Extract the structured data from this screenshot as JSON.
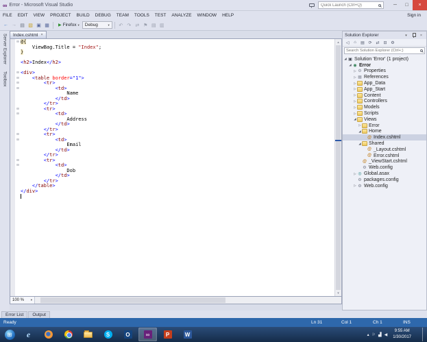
{
  "colors": {
    "statusbar": "#2e68ac",
    "taskbar_top": "#2b4c78",
    "taskbar_bottom": "#152c49",
    "close_button": "#d6493f",
    "selection": "#ccd2e2"
  },
  "glyphs": {
    "chevron_down": "▾",
    "scroll_up": "▴",
    "scroll_down": "▾",
    "fold_box": "⊟",
    "expander_expanded": "◢",
    "expander_collapsed": "▷"
  },
  "titlebar": {
    "logo_glyph": "∞",
    "title": "Error - Microsoft Visual Studio",
    "quick_launch_placeholder": "Quick Launch (Ctrl+Q)",
    "minimize_glyph": "─",
    "maximize_glyph": "□",
    "close_glyph": "×"
  },
  "menubar": {
    "items": [
      "FILE",
      "EDIT",
      "VIEW",
      "PROJECT",
      "BUILD",
      "DEBUG",
      "TEAM",
      "TOOLS",
      "TEST",
      "ANALYZE",
      "WINDOW",
      "HELP"
    ],
    "sign_in": "Sign in"
  },
  "toolbar": {
    "icons_left": [
      {
        "name": "navigate-back-icon",
        "glyph": "←",
        "color": "#3a76c4"
      },
      {
        "name": "navigate-forward-icon",
        "glyph": "→",
        "color": "#9aa0ae"
      },
      {
        "name": "new-file-icon",
        "glyph": "▤",
        "color": "#6b7380"
      },
      {
        "name": "open-file-icon",
        "glyph": "▧",
        "color": "#c9a227"
      },
      {
        "name": "save-icon",
        "glyph": "▣",
        "color": "#5b6b9e"
      },
      {
        "name": "save-all-icon",
        "glyph": "▦",
        "color": "#5b6b9e"
      }
    ],
    "run_play_glyph": "▶",
    "run_label": "Firefox",
    "config_label": "Debug",
    "icons_right": [
      {
        "name": "undo-icon",
        "glyph": "↶",
        "color": "#9aa0ae"
      },
      {
        "name": "redo-icon",
        "glyph": "↷",
        "color": "#9aa0ae"
      },
      {
        "name": "sync-icon",
        "glyph": "⇄",
        "color": "#9aa0ae"
      },
      {
        "name": "bookmark-icon",
        "glyph": "⚑",
        "color": "#9aa0ae"
      },
      {
        "name": "comment-icon",
        "glyph": "▤",
        "color": "#9aa0ae"
      },
      {
        "name": "outline-icon",
        "glyph": "▥",
        "color": "#9aa0ae"
      }
    ]
  },
  "side_tabs": {
    "items": [
      "Server Explorer",
      "Toolbox"
    ]
  },
  "editor": {
    "tab_label": "Index.cshtml",
    "tab_close_glyph": "×",
    "zoom_level": "100 %",
    "lines": [
      {
        "f": 1,
        "s": [
          [
            "rz",
            "@{"
          ]
        ]
      },
      {
        "s": [
          [
            "pl",
            "    ViewBag.Title = "
          ],
          [
            "st",
            "\"Index\""
          ],
          [
            "pl",
            ";"
          ]
        ]
      },
      {
        "s": [
          [
            "rz",
            "}"
          ]
        ]
      },
      {
        "s": []
      },
      {
        "s": [
          [
            "dl",
            "<"
          ],
          [
            "tg",
            "h2"
          ],
          [
            "dl",
            ">"
          ],
          [
            "pl",
            "Index"
          ],
          [
            "dl",
            "</"
          ],
          [
            "tg",
            "h2"
          ],
          [
            "dl",
            ">"
          ]
        ]
      },
      {
        "s": []
      },
      {
        "f": 1,
        "s": [
          [
            "dl",
            "<"
          ],
          [
            "tg",
            "div"
          ],
          [
            "dl",
            ">"
          ]
        ]
      },
      {
        "f": 1,
        "s": [
          [
            "pl",
            "    "
          ],
          [
            "dl",
            "<"
          ],
          [
            "tg",
            "table"
          ],
          [
            "pl",
            " "
          ],
          [
            "at",
            "border"
          ],
          [
            "dl",
            "=\"1\""
          ],
          [
            "dl",
            ">"
          ]
        ]
      },
      {
        "f": 1,
        "s": [
          [
            "pl",
            "        "
          ],
          [
            "dl",
            "<"
          ],
          [
            "tg",
            "tr"
          ],
          [
            "dl",
            ">"
          ]
        ]
      },
      {
        "f": 1,
        "s": [
          [
            "pl",
            "            "
          ],
          [
            "dl",
            "<"
          ],
          [
            "tg",
            "td"
          ],
          [
            "dl",
            ">"
          ]
        ]
      },
      {
        "s": [
          [
            "pl",
            "                Name"
          ]
        ]
      },
      {
        "s": [
          [
            "pl",
            "            "
          ],
          [
            "dl",
            "</"
          ],
          [
            "tg",
            "td"
          ],
          [
            "dl",
            ">"
          ]
        ]
      },
      {
        "s": [
          [
            "pl",
            "        "
          ],
          [
            "dl",
            "</"
          ],
          [
            "tg",
            "tr"
          ],
          [
            "dl",
            ">"
          ]
        ]
      },
      {
        "f": 1,
        "s": [
          [
            "pl",
            "        "
          ],
          [
            "dl",
            "<"
          ],
          [
            "tg",
            "tr"
          ],
          [
            "dl",
            ">"
          ]
        ]
      },
      {
        "f": 1,
        "s": [
          [
            "pl",
            "            "
          ],
          [
            "dl",
            "<"
          ],
          [
            "tg",
            "td"
          ],
          [
            "dl",
            ">"
          ]
        ]
      },
      {
        "s": [
          [
            "pl",
            "                Address"
          ]
        ]
      },
      {
        "s": [
          [
            "pl",
            "            "
          ],
          [
            "dl",
            "</"
          ],
          [
            "tg",
            "td"
          ],
          [
            "dl",
            ">"
          ]
        ]
      },
      {
        "s": [
          [
            "pl",
            "        "
          ],
          [
            "dl",
            "</"
          ],
          [
            "tg",
            "tr"
          ],
          [
            "dl",
            ">"
          ]
        ]
      },
      {
        "f": 1,
        "s": [
          [
            "pl",
            "        "
          ],
          [
            "dl",
            "<"
          ],
          [
            "tg",
            "tr"
          ],
          [
            "dl",
            ">"
          ]
        ]
      },
      {
        "f": 1,
        "s": [
          [
            "pl",
            "            "
          ],
          [
            "dl",
            "<"
          ],
          [
            "tg",
            "td"
          ],
          [
            "dl",
            ">"
          ]
        ]
      },
      {
        "s": [
          [
            "pl",
            "                Email"
          ]
        ]
      },
      {
        "s": [
          [
            "pl",
            "            "
          ],
          [
            "dl",
            "</"
          ],
          [
            "tg",
            "td"
          ],
          [
            "dl",
            ">"
          ]
        ]
      },
      {
        "s": [
          [
            "pl",
            "        "
          ],
          [
            "dl",
            "</"
          ],
          [
            "tg",
            "tr"
          ],
          [
            "dl",
            ">"
          ]
        ]
      },
      {
        "f": 1,
        "s": [
          [
            "pl",
            "        "
          ],
          [
            "dl",
            "<"
          ],
          [
            "tg",
            "tr"
          ],
          [
            "dl",
            ">"
          ]
        ]
      },
      {
        "f": 1,
        "s": [
          [
            "pl",
            "            "
          ],
          [
            "dl",
            "<"
          ],
          [
            "tg",
            "td"
          ],
          [
            "dl",
            ">"
          ]
        ]
      },
      {
        "s": [
          [
            "pl",
            "                Dob"
          ]
        ]
      },
      {
        "s": [
          [
            "pl",
            "            "
          ],
          [
            "dl",
            "</"
          ],
          [
            "tg",
            "td"
          ],
          [
            "dl",
            ">"
          ]
        ]
      },
      {
        "s": [
          [
            "pl",
            "        "
          ],
          [
            "dl",
            "</"
          ],
          [
            "tg",
            "tr"
          ],
          [
            "dl",
            ">"
          ]
        ]
      },
      {
        "s": [
          [
            "pl",
            "    "
          ],
          [
            "dl",
            "</"
          ],
          [
            "tg",
            "table"
          ],
          [
            "dl",
            ">"
          ]
        ]
      },
      {
        "s": [
          [
            "dl",
            "</"
          ],
          [
            "tg",
            "div"
          ],
          [
            "dl",
            ">"
          ]
        ]
      },
      {
        "caret": 1,
        "s": []
      }
    ]
  },
  "solution_explorer": {
    "title": "Solution Explorer",
    "header_icons": [
      {
        "name": "chevron-down-icon",
        "glyph": "▾"
      },
      {
        "name": "pin-icon",
        "glyph": ""
      },
      {
        "name": "close-icon",
        "glyph": "×"
      }
    ],
    "toolbar_icons": [
      {
        "name": "back-icon",
        "glyph": "◁"
      },
      {
        "name": "home-icon",
        "glyph": "⌂"
      },
      {
        "name": "show-all-files-icon",
        "glyph": "▤"
      },
      {
        "name": "refresh-icon",
        "glyph": "⟳"
      },
      {
        "name": "sync-with-active-document-icon",
        "glyph": "⇄"
      },
      {
        "name": "collapse-all-icon",
        "glyph": "⊟"
      },
      {
        "name": "properties-icon",
        "glyph": "⚙"
      }
    ],
    "search_placeholder": "Search Solution Explorer (Ctrl+;)",
    "icon_glyphs": {
      "folder": "",
      "cshtml": "@",
      "config": "⚙",
      "solution": "▣",
      "project": "◉",
      "references": "▦",
      "properties": "⚙",
      "asax": "◎"
    },
    "tree": [
      {
        "label": "Solution 'Error' (1 project)",
        "indent": 0,
        "icon": "solution",
        "expander": "expanded"
      },
      {
        "label": "Error",
        "indent": 1,
        "icon": "project",
        "expander": "expanded",
        "bold": true
      },
      {
        "label": "Properties",
        "indent": 2,
        "icon": "properties",
        "expander": "collapsed"
      },
      {
        "label": "References",
        "indent": 2,
        "icon": "references",
        "expander": "collapsed"
      },
      {
        "label": "App_Data",
        "indent": 2,
        "icon": "folder",
        "expander": "collapsed"
      },
      {
        "label": "App_Start",
        "indent": 2,
        "icon": "folder",
        "expander": "collapsed"
      },
      {
        "label": "Content",
        "indent": 2,
        "icon": "folder",
        "expander": "collapsed"
      },
      {
        "label": "Controllers",
        "indent": 2,
        "icon": "folder",
        "expander": "collapsed"
      },
      {
        "label": "Models",
        "indent": 2,
        "icon": "folder",
        "expander": "collapsed"
      },
      {
        "label": "Scripts",
        "indent": 2,
        "icon": "folder",
        "expander": "collapsed"
      },
      {
        "label": "Views",
        "indent": 2,
        "icon": "folder",
        "expander": "expanded"
      },
      {
        "label": "Error",
        "indent": 3,
        "icon": "folder",
        "expander": "collapsed"
      },
      {
        "label": "Home",
        "indent": 3,
        "icon": "folder",
        "expander": "expanded"
      },
      {
        "label": "Index.cshtml",
        "indent": 4,
        "icon": "cshtml",
        "selected": true
      },
      {
        "label": "Shared",
        "indent": 3,
        "icon": "folder",
        "expander": "expanded"
      },
      {
        "label": "_Layout.cshtml",
        "indent": 4,
        "icon": "cshtml"
      },
      {
        "label": "Error.cshtml",
        "indent": 4,
        "icon": "cshtml"
      },
      {
        "label": "_ViewStart.cshtml",
        "indent": 3,
        "icon": "cshtml"
      },
      {
        "label": "Web.config",
        "indent": 3,
        "icon": "config"
      },
      {
        "label": "Global.asax",
        "indent": 2,
        "icon": "asax",
        "expander": "collapsed"
      },
      {
        "label": "packages.config",
        "indent": 2,
        "icon": "config"
      },
      {
        "label": "Web.config",
        "indent": 2,
        "icon": "config",
        "expander": "collapsed"
      }
    ]
  },
  "bottom_panel": {
    "tabs": [
      "Error List",
      "Output"
    ]
  },
  "statusbar": {
    "message": "Ready",
    "line": "Ln 31",
    "column": "Col 1",
    "character": "Ch 1",
    "mode": "INS"
  },
  "taskbar": {
    "start_glyph": "⊞",
    "apps": [
      {
        "name": "internet-explorer",
        "glyph": "e"
      },
      {
        "name": "firefox",
        "glyph": ""
      },
      {
        "name": "chrome",
        "glyph": ""
      },
      {
        "name": "file-explorer",
        "glyph": ""
      },
      {
        "name": "skype",
        "glyph": "S"
      },
      {
        "name": "outlook",
        "glyph": "O"
      },
      {
        "name": "visual-studio",
        "glyph": "∞",
        "active": true
      },
      {
        "name": "powerpoint",
        "glyph": "P"
      },
      {
        "name": "word",
        "glyph": "W"
      }
    ],
    "tray_icons": [
      {
        "name": "show-hidden-icons-icon",
        "glyph": "▴"
      },
      {
        "name": "action-center-icon",
        "glyph": "⚐"
      },
      {
        "name": "network-icon",
        "glyph": "▟"
      },
      {
        "name": "volume-icon",
        "glyph": "◀"
      }
    ],
    "time": "9:55 AM",
    "date": "1/30/2017"
  }
}
